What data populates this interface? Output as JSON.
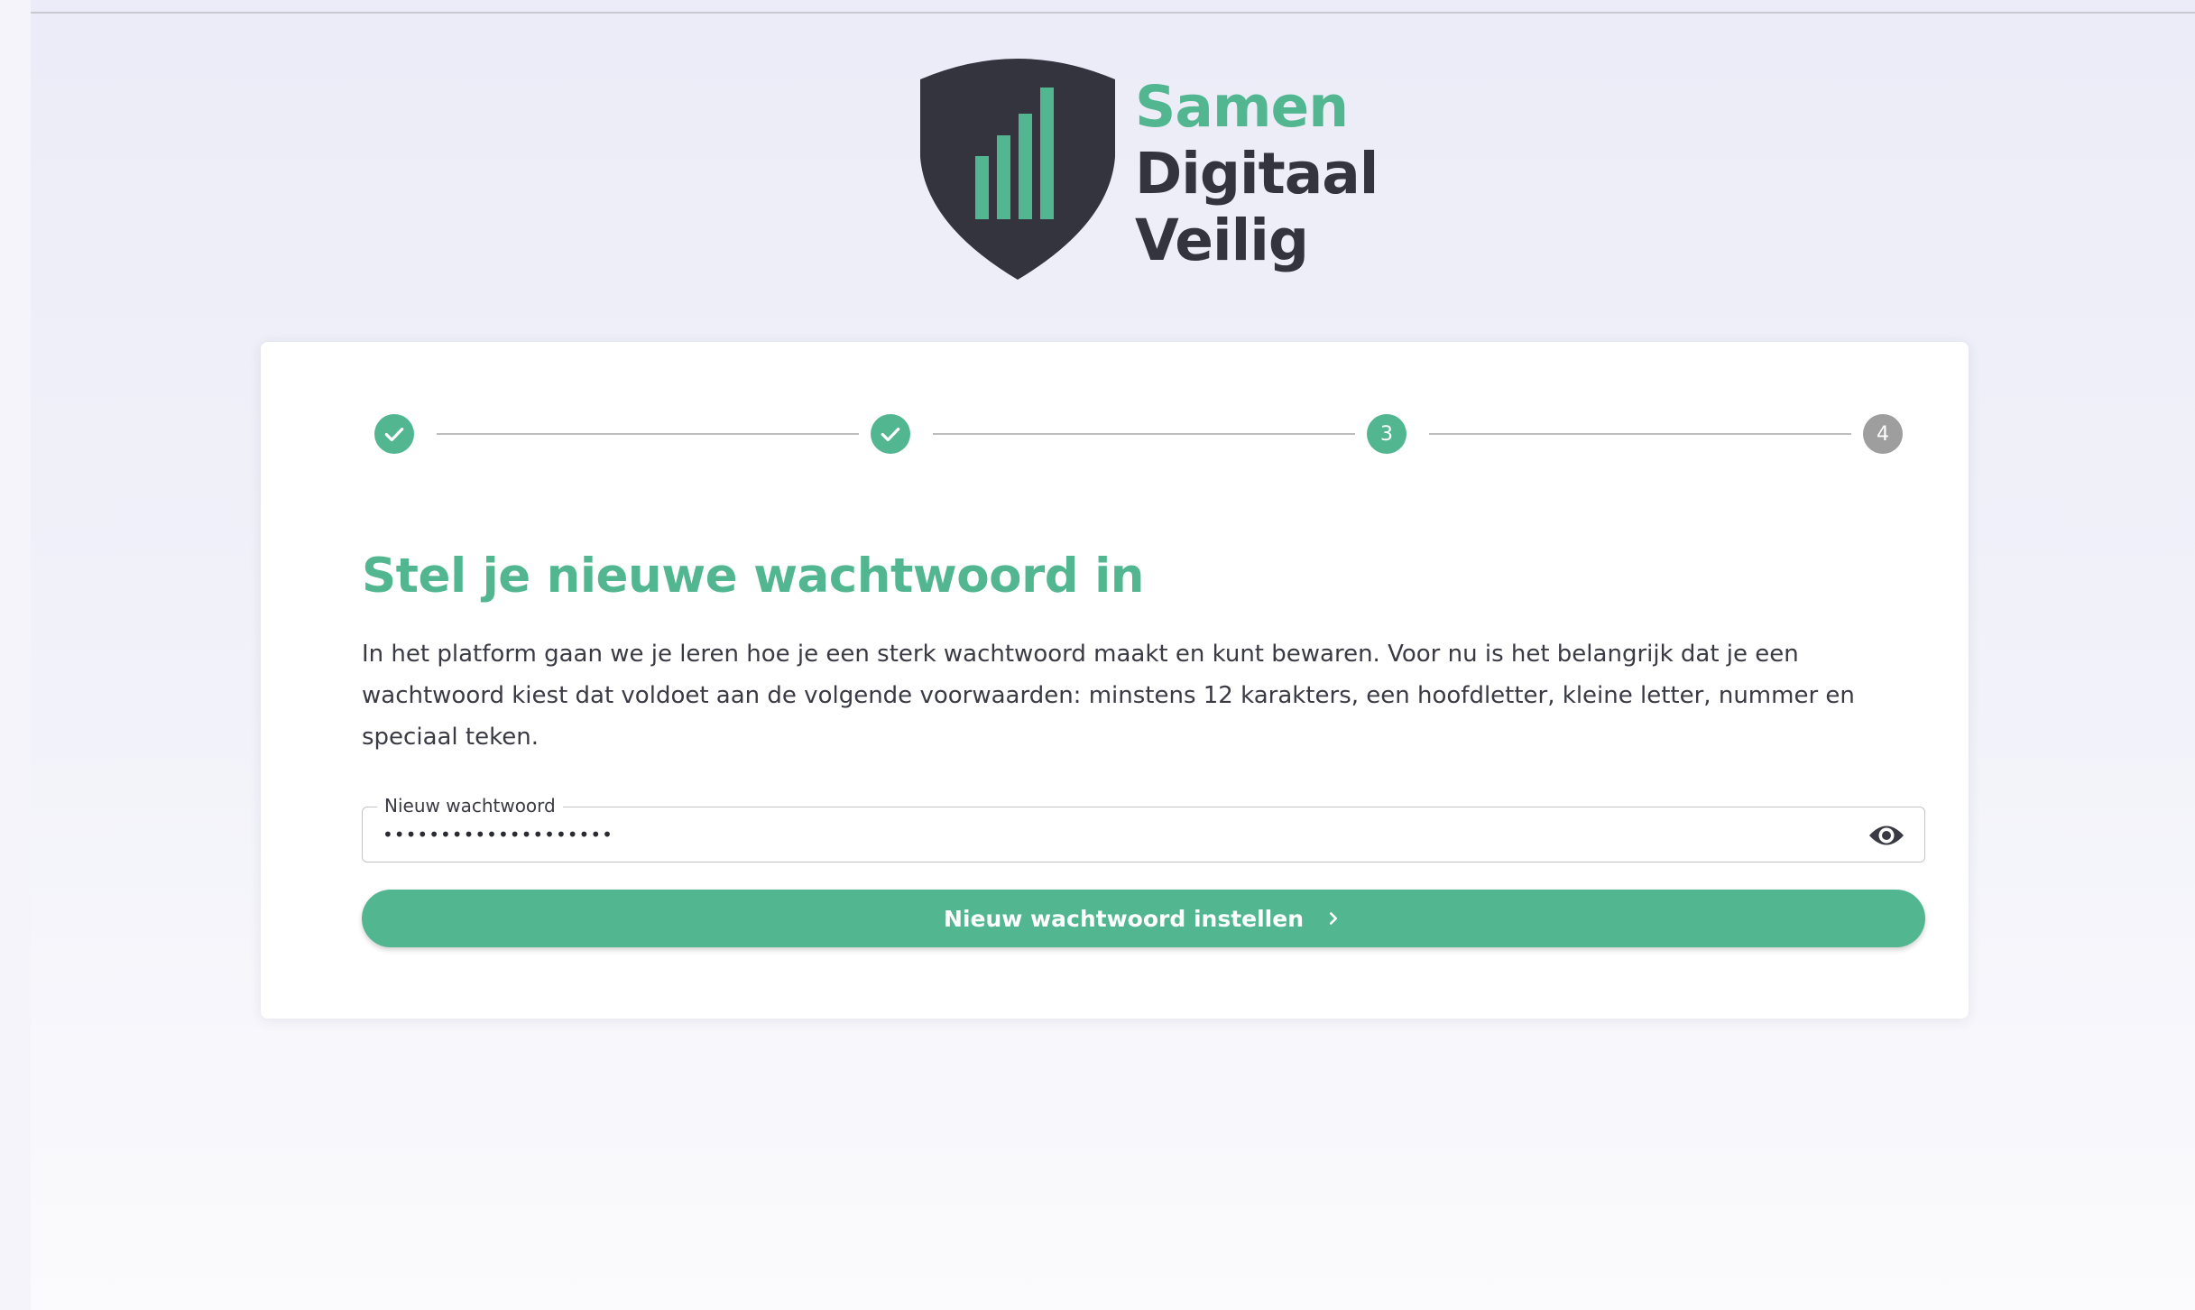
{
  "logo": {
    "line1": "Samen",
    "line2": "Digitaal",
    "line3": "Veilig",
    "icon": "shield-bars-icon"
  },
  "stepper": {
    "steps": [
      {
        "label": "",
        "state": "done",
        "icon": "check-icon"
      },
      {
        "label": "",
        "state": "done",
        "icon": "check-icon"
      },
      {
        "label": "3",
        "state": "active"
      },
      {
        "label": "4",
        "state": "todo"
      }
    ]
  },
  "form": {
    "title": "Stel je nieuwe wachtwoord in",
    "description": "In het platform gaan we je leren hoe je een sterk wachtwoord maakt en kunt bewaren. Voor nu is het belangrijk dat je een wachtwoord kiest dat voldoet aan de volgende voorwaarden: minstens 12 karakters, een hoofdletter, kleine letter, nummer en speciaal teken.",
    "password_label": "Nieuw wachtwoord",
    "password_value": "••••••••••••••••••••",
    "visibility_icon": "eye-icon",
    "submit_label": "Nieuw wachtwoord instellen",
    "submit_icon": "chevron-right-icon"
  },
  "colors": {
    "accent": "#52b791",
    "dark": "#34343f",
    "inactive_step": "#9e9e9e",
    "background": "#ececf8"
  }
}
